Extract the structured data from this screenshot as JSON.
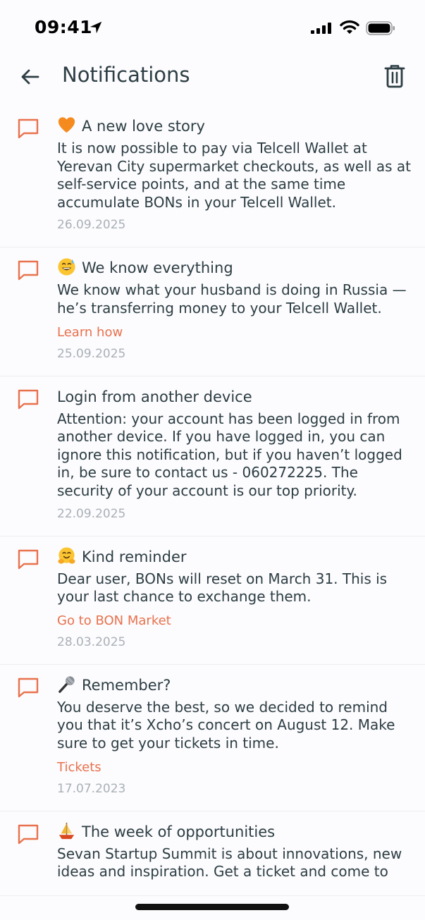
{
  "status_bar": {
    "time": "09:41"
  },
  "header": {
    "title": "Notifications"
  },
  "notifications": [
    {
      "emoji": "orange-heart",
      "title": "A new love story",
      "text": "It is now possible to pay via Telcell Wallet at Yerevan City supermarket checkouts, as well as at self-service points, and at the same time accumulate BONs in your Telcell Wallet.",
      "link": "",
      "date": "26.09.2025"
    },
    {
      "emoji": "grinning-face-with-sweat",
      "title": "We know everything",
      "text": "We know what your husband is doing in Russia — he’s transferring money to your Telcell Wallet.",
      "link": "Learn how",
      "date": "25.09.2025"
    },
    {
      "emoji": "",
      "title": "Login from another device",
      "text": "Attention: your account has been logged in from another device. If you have logged in, you can ignore this notification, but if you haven’t logged in, be sure to contact us - 060272225. The security of your account is our top priority.",
      "link": "",
      "date": "22.09.2025"
    },
    {
      "emoji": "hugging-face",
      "title": "Kind reminder",
      "text": "Dear user, BONs will reset on March 31. This is your last chance to exchange them.",
      "link": "Go to BON Market",
      "date": "28.03.2025"
    },
    {
      "emoji": "microphone",
      "title": "Remember?",
      "text": "You deserve the best, so we decided to remind you that it’s Xcho’s concert on August 12. Make sure to get your tickets in time.",
      "link": "Tickets",
      "date": "17.07.2023"
    },
    {
      "emoji": "sailboat",
      "title": "The week of opportunities",
      "text": "Sevan Startup Summit is about innovations, new ideas and inspiration. Get a ticket and come to",
      "link": "",
      "date": ""
    }
  ],
  "colors": {
    "accent": "#e8724d",
    "text": "#2c3e44",
    "date": "#a9b1b6",
    "divider": "#eeeef1"
  },
  "icons": {
    "notification_item": "chat-bubble-icon",
    "back": "arrow-left-icon",
    "delete": "trash-icon"
  }
}
